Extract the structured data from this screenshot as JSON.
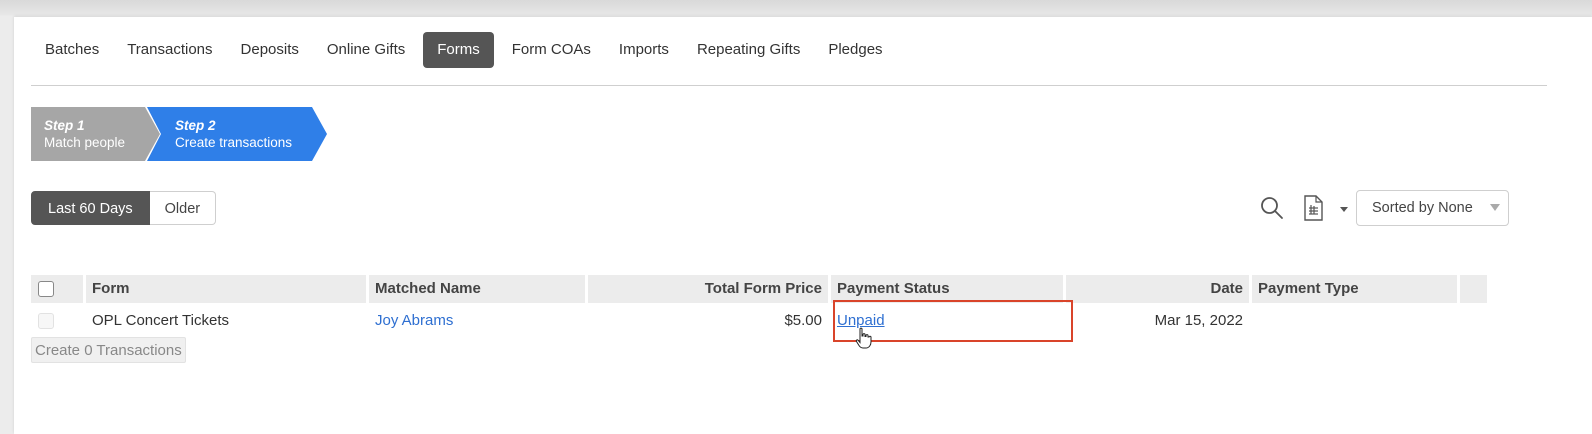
{
  "tabs": [
    {
      "label": "Batches",
      "active": false
    },
    {
      "label": "Transactions",
      "active": false
    },
    {
      "label": "Deposits",
      "active": false
    },
    {
      "label": "Online Gifts",
      "active": false
    },
    {
      "label": "Forms",
      "active": true
    },
    {
      "label": "Form COAs",
      "active": false
    },
    {
      "label": "Imports",
      "active": false
    },
    {
      "label": "Repeating Gifts",
      "active": false
    },
    {
      "label": "Pledges",
      "active": false
    }
  ],
  "steps": [
    {
      "number": "Step 1",
      "label": "Match people",
      "state": "completed",
      "color": "#a6a6a6"
    },
    {
      "number": "Step 2",
      "label": "Create transactions",
      "state": "current",
      "color": "#2f7fe8"
    }
  ],
  "filters": {
    "options": [
      "Last 60 Days",
      "Older"
    ],
    "selected": "Last 60 Days"
  },
  "tools": {
    "search_icon": "search-icon",
    "export_icon": "export-document-icon",
    "sort_value": "Sorted by None"
  },
  "table": {
    "columns": [
      "",
      "Form",
      "Matched Name",
      "Total Form Price",
      "Payment Status",
      "Date",
      "Payment Type",
      ""
    ],
    "rows": [
      {
        "selected": false,
        "form": "OPL Concert Tickets",
        "matched_name": "Joy Abrams",
        "total_form_price": "$5.00",
        "payment_status": "Unpaid",
        "date": "Mar 15, 2022",
        "payment_type": ""
      }
    ]
  },
  "actions": {
    "create_label": "Create 0 Transactions"
  },
  "colors": {
    "accent_blue": "#2f7fe8",
    "link_blue": "#2e6fd1",
    "highlight_red": "#d9442a",
    "active_dark": "#555555"
  }
}
